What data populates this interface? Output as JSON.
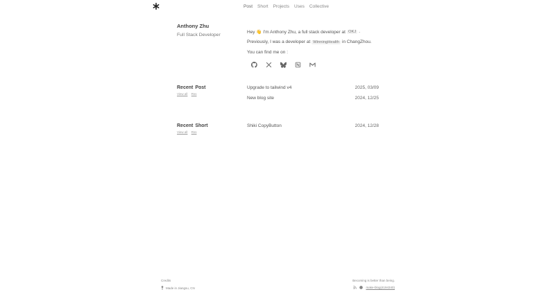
{
  "nav": {
    "items": [
      "Post",
      "Short",
      "Projects",
      "Uses",
      "Collective"
    ],
    "active_index": 0
  },
  "profile": {
    "name": "Anthony Zhu",
    "role": "Full Stack Developer"
  },
  "bio": {
    "greeting": "Hey 👋 I'm Anthony Zhu, a full stack developer at",
    "company": "OKJ",
    "greeting_end": ".",
    "previous_prefix": "Previously, I was a developer at",
    "previous_company": "WinningHealth",
    "previous_suffix": "in ChangZhou.",
    "find_me": "You can find me on :"
  },
  "social": {
    "icons": [
      "github-icon",
      "x-icon",
      "bluesky-icon",
      "notion-icon",
      "gmail-icon"
    ]
  },
  "recent_post": {
    "title_a": "Recent",
    "title_b": "Post",
    "view_all": "View all",
    "rss": "Rss",
    "items": [
      {
        "title": "Upgrade to tailwind v4",
        "date": "2025, 03/09"
      },
      {
        "title": "New blog site",
        "date": "2024, 12/25"
      }
    ]
  },
  "recent_short": {
    "title_a": "Recent",
    "title_b": "Short",
    "view_all": "View all",
    "rss": "Rss",
    "items": [
      {
        "title": "Shiki CopyButton",
        "date": "2024, 12/28"
      }
    ]
  },
  "footer": {
    "credits": "Credits",
    "made_in": "Made in Jiangsu, CN",
    "motto": "Becoming is better than being.",
    "repo": "make-blog(4194340)"
  }
}
